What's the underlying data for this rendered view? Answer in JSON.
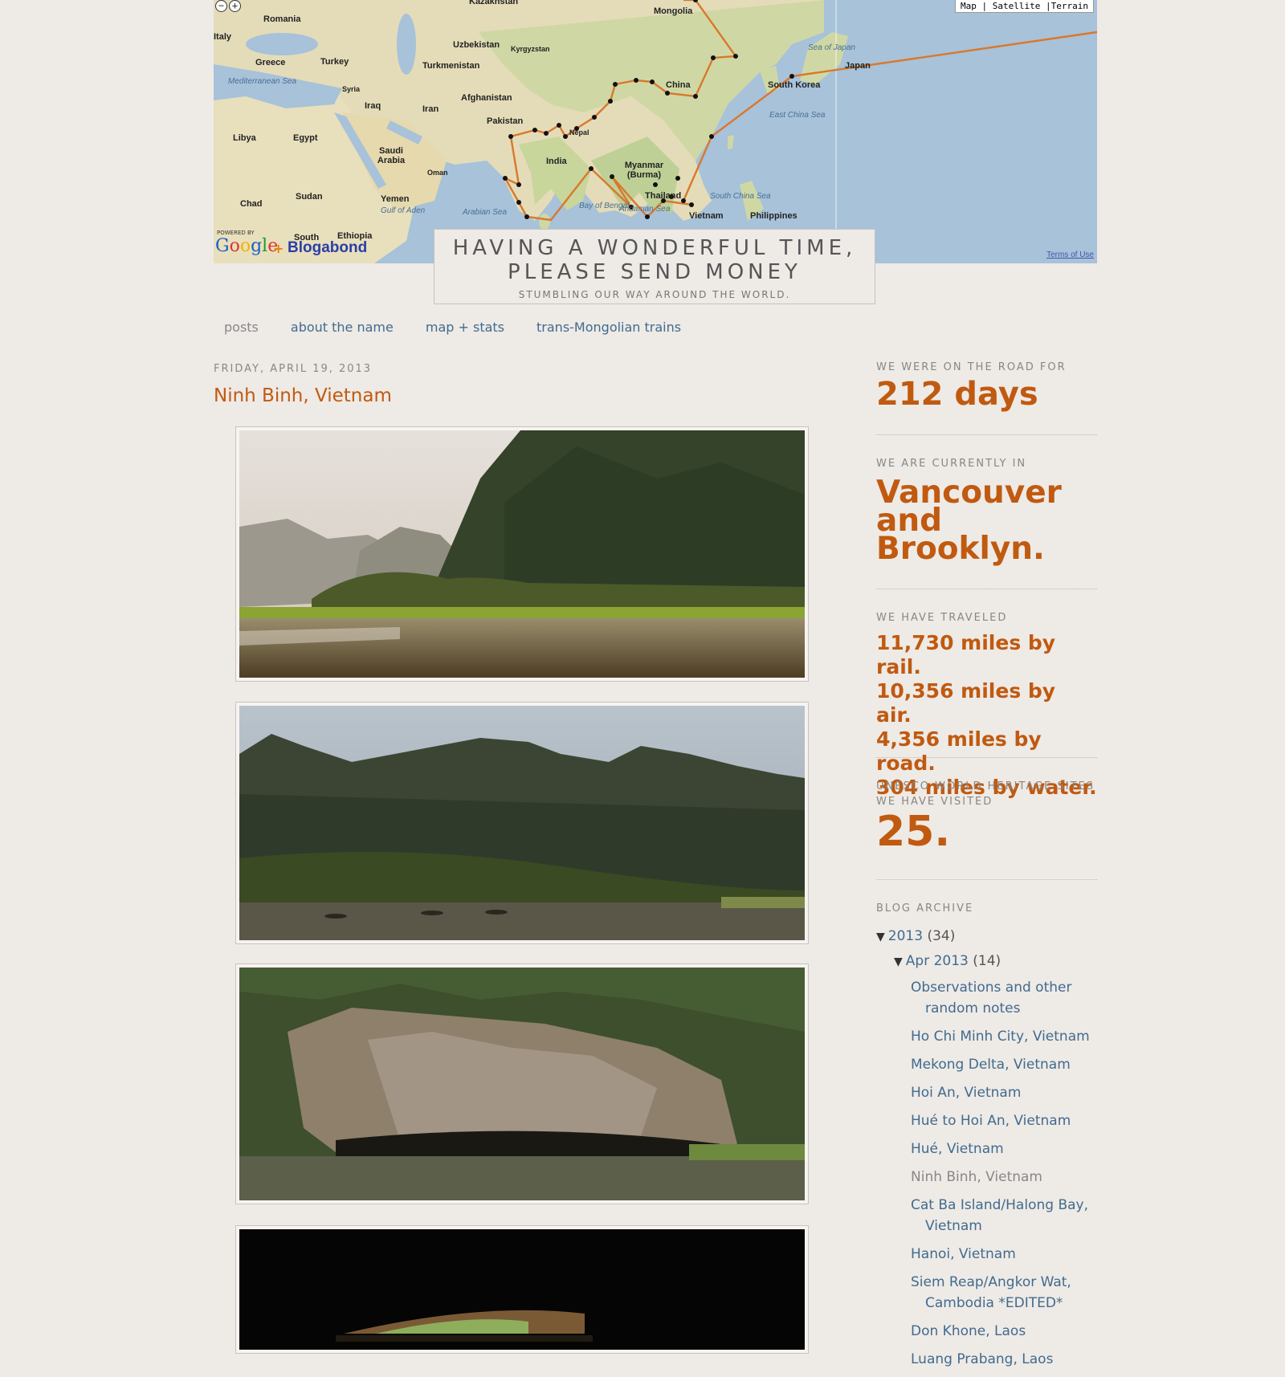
{
  "map": {
    "type_controls": "Map | Satellite |Terrain",
    "zoom_out": "−",
    "zoom_in": "+",
    "powered_by": "POWERED BY",
    "google": "Google",
    "plus": "+",
    "blogabond": "Blogabond",
    "terms": "Terms of Use",
    "labels": [
      {
        "text": "Kazakhstan",
        "kind": "land"
      },
      {
        "text": "Mongolia",
        "kind": "land"
      },
      {
        "text": "Romania",
        "kind": "land"
      },
      {
        "text": "Italy",
        "kind": "land"
      },
      {
        "text": "Uzbekistan",
        "kind": "land"
      },
      {
        "text": "Kyrgyzstan",
        "kind": "land"
      },
      {
        "text": "Sea of Japan",
        "kind": "sea"
      },
      {
        "text": "Greece",
        "kind": "land"
      },
      {
        "text": "Turkey",
        "kind": "land"
      },
      {
        "text": "Turkmenistan",
        "kind": "land"
      },
      {
        "text": "Japan",
        "kind": "land"
      },
      {
        "text": "Mediterranean Sea",
        "kind": "sea"
      },
      {
        "text": "Syria",
        "kind": "land"
      },
      {
        "text": "China",
        "kind": "land"
      },
      {
        "text": "South Korea",
        "kind": "land"
      },
      {
        "text": "Iraq",
        "kind": "land"
      },
      {
        "text": "Iran",
        "kind": "land"
      },
      {
        "text": "Afghanistan",
        "kind": "land"
      },
      {
        "text": "East China Sea",
        "kind": "sea"
      },
      {
        "text": "Pakistan",
        "kind": "land"
      },
      {
        "text": "Libya",
        "kind": "land"
      },
      {
        "text": "Egypt",
        "kind": "land"
      },
      {
        "text": "Nepal",
        "kind": "land"
      },
      {
        "text": "Saudi Arabia",
        "kind": "land"
      },
      {
        "text": "India",
        "kind": "land"
      },
      {
        "text": "Myanmar (Burma)",
        "kind": "land"
      },
      {
        "text": "Oman",
        "kind": "land"
      },
      {
        "text": "Chad",
        "kind": "land"
      },
      {
        "text": "Sudan",
        "kind": "land"
      },
      {
        "text": "Yemen",
        "kind": "land"
      },
      {
        "text": "Gulf of Aden",
        "kind": "sea"
      },
      {
        "text": "Arabian Sea",
        "kind": "sea"
      },
      {
        "text": "Bay of Bengal",
        "kind": "sea"
      },
      {
        "text": "Andaman Sea",
        "kind": "sea"
      },
      {
        "text": "Thailand",
        "kind": "land"
      },
      {
        "text": "South China Sea",
        "kind": "sea"
      },
      {
        "text": "Vietnam",
        "kind": "land"
      },
      {
        "text": "Philippines",
        "kind": "land"
      },
      {
        "text": "South",
        "kind": "land"
      },
      {
        "text": "Ethiopia",
        "kind": "land"
      }
    ]
  },
  "blog": {
    "title": "HAVING A WONDERFUL TIME, PLEASE SEND MONEY",
    "description": "STUMBLING OUR WAY AROUND THE WORLD."
  },
  "nav": {
    "items": [
      {
        "label": "posts",
        "current": true
      },
      {
        "label": "about the name",
        "current": false
      },
      {
        "label": "map + stats",
        "current": false
      },
      {
        "label": "trans-Mongolian trains",
        "current": false
      }
    ]
  },
  "post": {
    "date": "FRIDAY, APRIL 19, 2013",
    "title": "Ninh Binh, Vietnam"
  },
  "sidebar": {
    "road": {
      "heading": "WE WERE ON THE ROAD FOR",
      "value": "212 days"
    },
    "location": {
      "heading": "WE ARE CURRENTLY IN",
      "value": "Vancouver and Brooklyn."
    },
    "traveled": {
      "heading": "WE HAVE TRAVELED",
      "lines": [
        "11,730 miles by rail.",
        "10,356 miles by air.",
        "4,356 miles by road.",
        "304 miles by water."
      ]
    },
    "unesco": {
      "heading": "UNESCO WORLD HERITAGE SITES WE HAVE VISITED",
      "value": "25."
    },
    "archive": {
      "heading": "BLOG ARCHIVE",
      "year": "2013",
      "year_count": "(34)",
      "month": "Apr 2013",
      "month_count": "(14)",
      "posts": [
        {
          "label": "Observations and other random notes",
          "current": false
        },
        {
          "label": "Ho Chi Minh City, Vietnam",
          "current": false
        },
        {
          "label": "Mekong Delta, Vietnam",
          "current": false
        },
        {
          "label": "Hoi An, Vietnam",
          "current": false
        },
        {
          "label": "Hué to Hoi An, Vietnam",
          "current": false
        },
        {
          "label": "Hué, Vietnam",
          "current": false
        },
        {
          "label": "Ninh Binh, Vietnam",
          "current": true
        },
        {
          "label": "Cat Ba Island/Halong Bay, Vietnam",
          "current": false
        },
        {
          "label": "Hanoi, Vietnam",
          "current": false
        },
        {
          "label": "Siem Reap/Angkor Wat, Cambodia *EDITED*",
          "current": false
        },
        {
          "label": "Don Khone, Laos",
          "current": false
        },
        {
          "label": "Luang Prabang, Laos",
          "current": false
        }
      ]
    }
  },
  "colors": {
    "accent": "#c05a10",
    "link": "#416b8e",
    "background": "#eeeae6",
    "route": "#d9782d"
  }
}
